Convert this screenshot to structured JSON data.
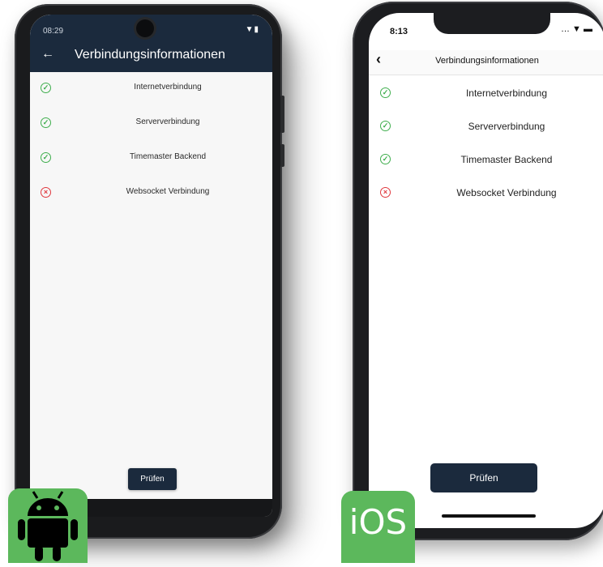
{
  "android": {
    "status": {
      "time": "08:29",
      "icons": "▼▮"
    },
    "header": {
      "back_glyph": "←",
      "title": "Verbindungsinformationen"
    },
    "items": [
      {
        "label": "Internetverbindung",
        "status": "ok",
        "glyph": "✓"
      },
      {
        "label": "Serververbindung",
        "status": "ok",
        "glyph": "✓"
      },
      {
        "label": "Timemaster Backend",
        "status": "ok",
        "glyph": "✓"
      },
      {
        "label": "Websocket Verbindung",
        "status": "error",
        "glyph": "×"
      }
    ],
    "check_button": "Prüfen"
  },
  "ios": {
    "status": {
      "time": "8:13",
      "icons": "… ▼ ▬"
    },
    "nav": {
      "back_glyph": "‹",
      "title": "Verbindungsinformationen"
    },
    "items": [
      {
        "label": "Internetverbindung",
        "status": "ok",
        "glyph": "✓"
      },
      {
        "label": "Serververbindung",
        "status": "ok",
        "glyph": "✓"
      },
      {
        "label": "Timemaster Backend",
        "status": "ok",
        "glyph": "✓"
      },
      {
        "label": "Websocket Verbindung",
        "status": "error",
        "glyph": "×"
      }
    ],
    "check_button": "Prüfen"
  },
  "badges": {
    "ios_label": "iOS",
    "android_icon": "android-robot-icon"
  },
  "colors": {
    "header": "#1b2a3d",
    "ok": "#3fae4d",
    "error": "#e0383e",
    "badge": "#5cb85c"
  }
}
